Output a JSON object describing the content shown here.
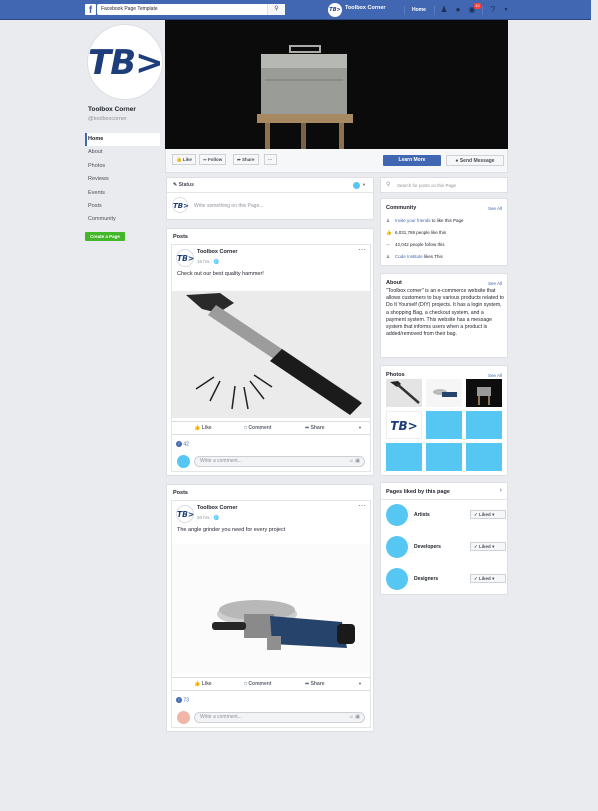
{
  "topbar": {
    "search_value": "Facebook Page Template",
    "page_name": "Toolbox Corner",
    "home": "Home",
    "notifications_count": "10",
    "avatar_text": "TB>"
  },
  "profile": {
    "logo": "TB>",
    "name": "Toolbox Corner",
    "handle": "@toolboxcorner"
  },
  "nav": {
    "items": [
      "Home",
      "About",
      "Photos",
      "Reviews",
      "Events",
      "Posts",
      "Community"
    ],
    "create_page": "Create a Page"
  },
  "actions": {
    "like": "Like",
    "follow": "Follow",
    "share": "Share",
    "more": "···",
    "learn_more": "Learn More",
    "send_message": "Send Message"
  },
  "composer": {
    "tab": "Status",
    "placeholder": "Write something on this Page..."
  },
  "posts": [
    {
      "section": "Posts",
      "author": "Toolbox Corner",
      "time": "16 hrs",
      "text": "Check out our best quality hammer!",
      "like": "Like",
      "comment": "Comment",
      "share": "Share",
      "reactions": "42",
      "comment_placeholder": "Write a comment..."
    },
    {
      "section": "Posts",
      "author": "Toolbox Corner",
      "time": "20 hrs",
      "text": "The angle grinder you need for every project",
      "like": "Like",
      "comment": "Comment",
      "share": "Share",
      "reactions": "73",
      "comment_placeholder": "Write a comment..."
    }
  ],
  "right": {
    "search_placeholder": "Search for posts on this Page",
    "community": {
      "title": "Community",
      "see_all": "See All",
      "invite_link": "Invite your friends",
      "invite_rest": "to like this Page",
      "likes": "6,031,769 people like this",
      "follows": "42,042 people follow this",
      "liked_by_link": "Code Institute",
      "liked_by_rest": "likes This"
    },
    "about": {
      "title": "About",
      "see_all": "See All",
      "text": "\"Toolbox corner\" is an e-commerce website that allows customers to buy various products related to Do It Yourself (DIY) projects. It has a login system, a shopping Bag, a checkout system, and a payment system. This website has a message system that informs users when a product is added/removed from their bag."
    },
    "photos": {
      "title": "Photos",
      "see_all": "See All",
      "logo": "TB>"
    },
    "liked_pages": {
      "title": "Pages liked by this page",
      "items": [
        {
          "name": "Artists",
          "button": "Liked"
        },
        {
          "name": "Developers",
          "button": "Liked"
        },
        {
          "name": "Designers",
          "button": "Liked"
        }
      ]
    }
  },
  "colors": {
    "brand": "#4267b2",
    "placeholder_blue": "#55c7f2",
    "create_green": "#42b72a",
    "logo_navy": "#1d3e7a"
  }
}
